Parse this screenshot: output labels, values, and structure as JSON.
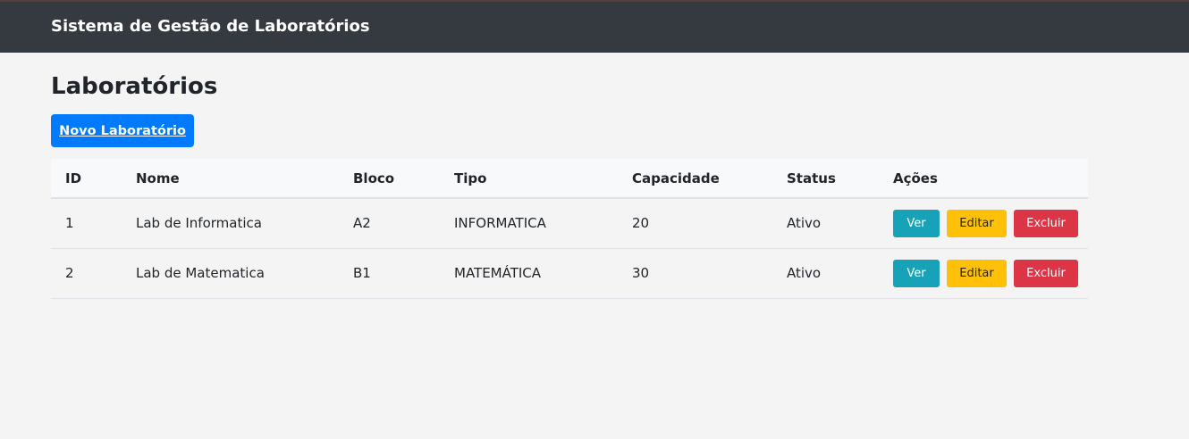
{
  "navbar": {
    "brand": "Sistema de Gestão de Laboratórios"
  },
  "page": {
    "title": "Laboratórios",
    "new_button_label": "Novo Laboratório"
  },
  "table": {
    "headers": {
      "id": "ID",
      "name": "Nome",
      "block": "Bloco",
      "type": "Tipo",
      "capacity": "Capacidade",
      "status": "Status",
      "actions": "Ações"
    },
    "rows": [
      {
        "id": "1",
        "name": "Lab de Informatica",
        "block": "A2",
        "type": "INFORMATICA",
        "capacity": "20",
        "status": "Ativo"
      },
      {
        "id": "2",
        "name": "Lab de Matematica",
        "block": "B1",
        "type": "MATEMÁTICA",
        "capacity": "30",
        "status": "Ativo"
      }
    ],
    "actions": {
      "view_label": "Ver",
      "edit_label": "Editar",
      "delete_label": "Excluir"
    }
  },
  "colors": {
    "navbar_bg": "#343a40",
    "page_bg": "#f4f4f4",
    "primary": "#007bff",
    "info": "#17a2b8",
    "warning": "#ffc107",
    "danger": "#dc3545"
  }
}
